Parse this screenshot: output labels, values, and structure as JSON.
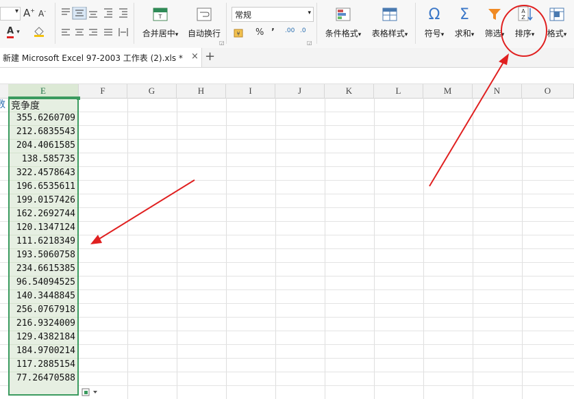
{
  "ribbon": {
    "font_grow": "A",
    "font_shrink": "A",
    "font_color_glyph": "A",
    "merge_label": "合并居中",
    "wrap_label": "自动换行",
    "number_format": "常规",
    "percent": "%",
    "comma": "’",
    "dec_inc": ".00",
    "dec_dec": ".0",
    "cond_format_label": "条件格式",
    "table_style_label": "表格样式",
    "symbol_label": "符号",
    "sum_label": "求和",
    "filter_label": "筛选",
    "sort_label": "排序",
    "format_label": "格式",
    "dropdown": "▾"
  },
  "tabs": {
    "file_tab": "新建 Microsoft Excel 97-2003 工作表 (2).xls *",
    "close": "×",
    "add": "+"
  },
  "columns": [
    "E",
    "F",
    "G",
    "H",
    "I",
    "J",
    "K",
    "L",
    "M",
    "N",
    "O"
  ],
  "sheet": {
    "left_partial": "数",
    "header": "竞争度",
    "values": [
      "355.6260709",
      "212.6835543",
      "204.4061585",
      "138.585735",
      "322.4578643",
      "196.6535611",
      "199.0157426",
      "162.2692744",
      "120.1347124",
      "111.6218349",
      "193.5060758",
      "234.6615385",
      "96.54094525",
      "140.3448845",
      "256.0767918",
      "216.9324009",
      "129.4382184",
      "184.9700214",
      "117.2885154",
      "77.26470588"
    ]
  },
  "colors": {
    "accent": "#3a9a5e",
    "annotation": "#e02020",
    "icon_blue": "#3c78c8"
  }
}
